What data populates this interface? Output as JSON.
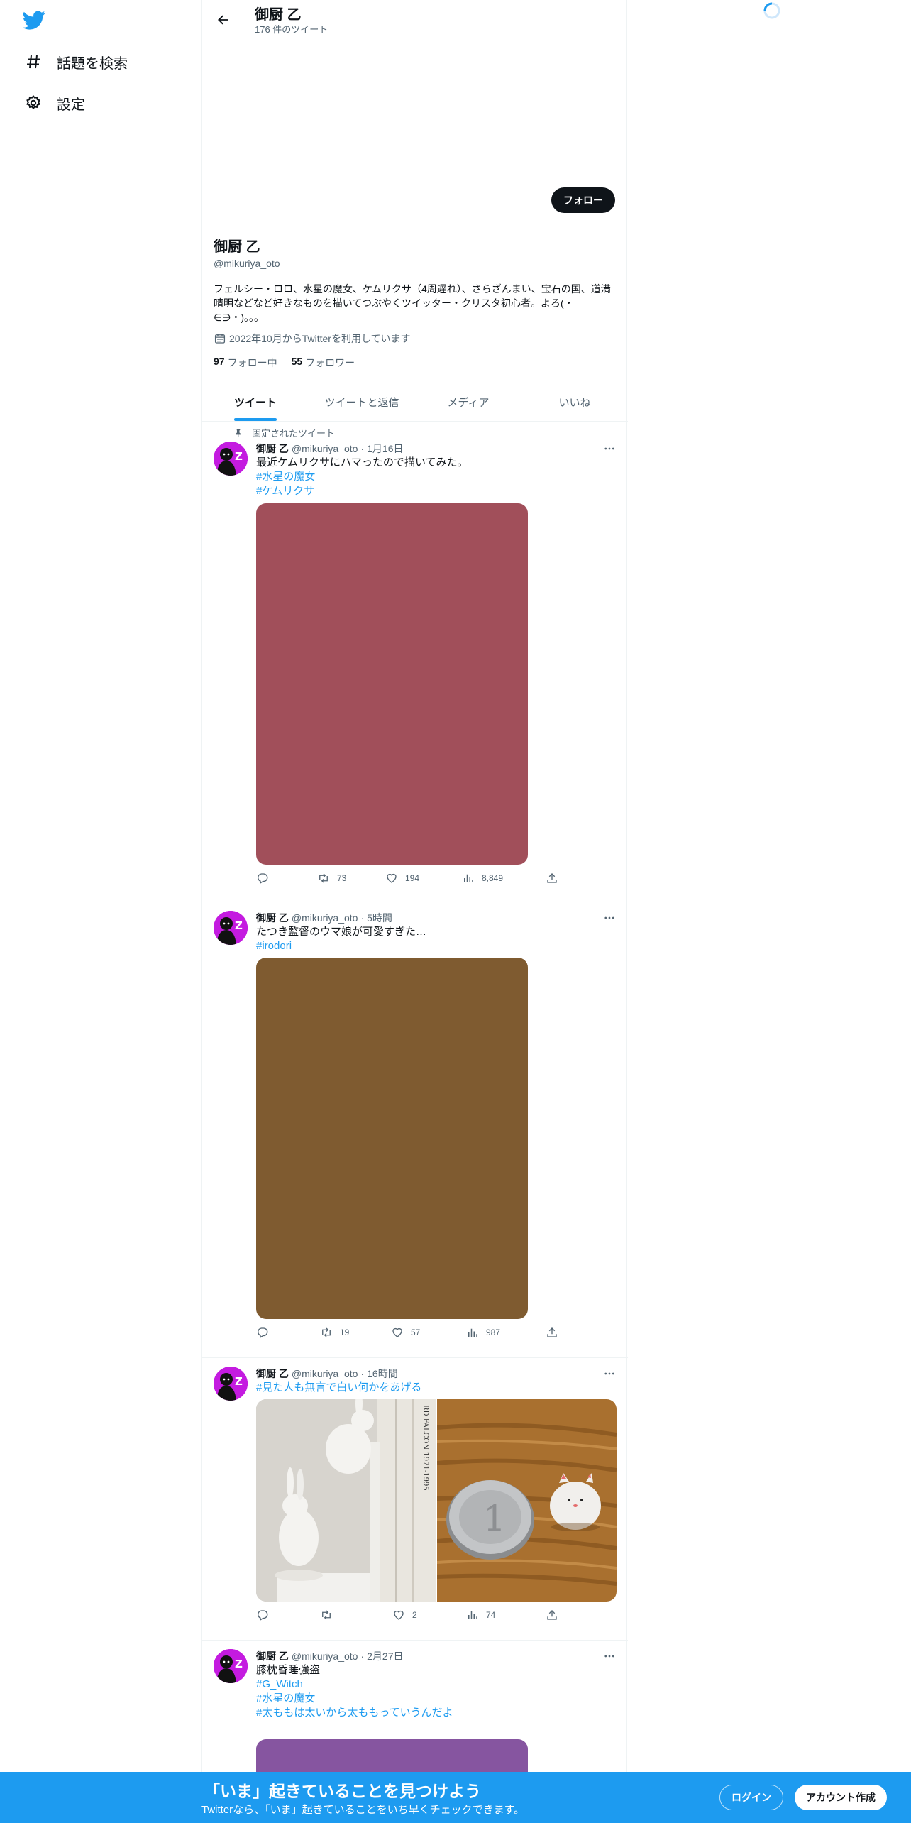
{
  "sidebar": {
    "logo": "twitter-bird-icon",
    "items": [
      {
        "icon": "hashtag-icon",
        "label": "話題を検索"
      },
      {
        "icon": "gear-icon",
        "label": "設定"
      }
    ]
  },
  "header": {
    "name": "御厨 乙",
    "tweet_count": "176 件のツイート"
  },
  "profile": {
    "follow_label": "フォロー",
    "name": "御厨 乙",
    "handle": "@mikuriya_oto",
    "bio": "フェルシー・ロロ、水星の魔女、ケムリクサ（4周遅れ）、さらざんまい、宝石の国、道満晴明などなど好きなものを描いてつぶやくツイッター・クリスタ初心者。よろ(・∈∋・)。。。",
    "joined": "2022年10月からTwitterを利用しています",
    "following_count": "97",
    "following_label": "フォロー中",
    "followers_count": "55",
    "followers_label": "フォロワー"
  },
  "tabs": [
    {
      "label": "ツイート",
      "active": true
    },
    {
      "label": "ツイートと返信",
      "active": false
    },
    {
      "label": "メディア",
      "active": false
    },
    {
      "label": "いいね",
      "active": false
    }
  ],
  "tweets": [
    {
      "pinned_label": "固定されたツイート",
      "name": "御厨 乙",
      "handle": "@mikuriya_oto",
      "dot": "·",
      "time": "1月16日",
      "text": "最近ケムリクサにハマったので描いてみた。",
      "tags": [
        "#水星の魔女",
        "#ケムリクサ"
      ],
      "media_color": "#a14f5a",
      "reply_count": "",
      "retweet_count": "73",
      "like_count": "194",
      "view_count": "8,849"
    },
    {
      "name": "御厨 乙",
      "handle": "@mikuriya_oto",
      "dot": "·",
      "time": "5時間",
      "text": "たつき監督のウマ娘が可愛すぎた…",
      "tags": [
        "#irodori"
      ],
      "media_color": "#7f5b30",
      "reply_count": "",
      "retweet_count": "19",
      "like_count": "57",
      "view_count": "987"
    },
    {
      "name": "御厨 乙",
      "handle": "@mikuriya_oto",
      "dot": "·",
      "time": "16時間",
      "text": "",
      "tags": [
        "#見た人も無言で白い何かをあげる"
      ],
      "book_spine_text": "RD FALCON 1971-1995",
      "coin_numeral": "1",
      "reply_count": "",
      "retweet_count": "",
      "like_count": "2",
      "view_count": "74"
    },
    {
      "name": "御厨 乙",
      "handle": "@mikuriya_oto",
      "dot": "·",
      "time": "2月27日",
      "text": "膝枕昏睡強盗",
      "tags": [
        "#G_Witch",
        "#水星の魔女",
        "#太ももは太いから太ももっていうんだよ"
      ],
      "media_color": "#8655a0"
    }
  ],
  "bottom_bar": {
    "title": "「いま」起きていることを見つけよう",
    "subtitle": "Twitterなら、「いま」起きていることをいち早くチェックできます。",
    "login_label": "ログイン",
    "signup_label": "アカウント作成"
  },
  "colors": {
    "accent": "#1d9bf0",
    "avatar": "#c41be0",
    "text_primary": "#0f1419",
    "text_secondary": "#536471"
  }
}
